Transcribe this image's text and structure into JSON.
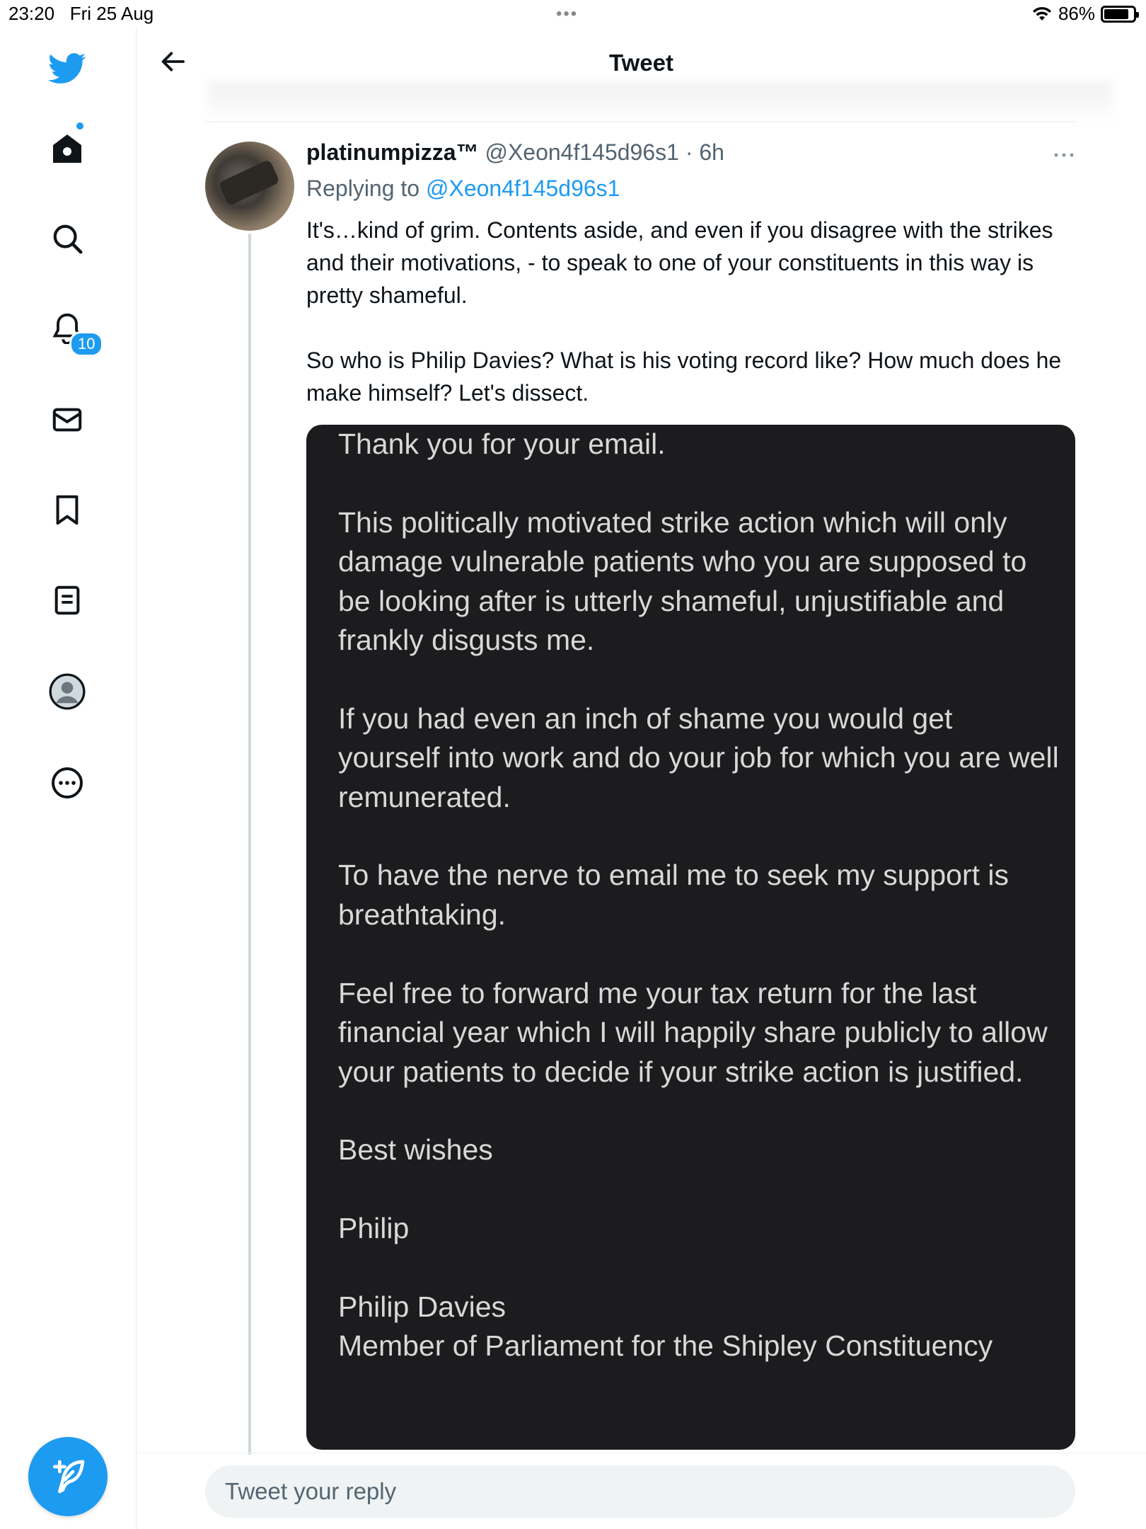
{
  "status_bar": {
    "time": "23:20",
    "date": "Fri 25 Aug",
    "dots": "•••",
    "battery": "86%",
    "battery_level": 0.86
  },
  "sidebar": {
    "items": [
      {
        "icon": "home-icon"
      },
      {
        "icon": "search-icon"
      },
      {
        "icon": "notifications-icon",
        "badge": "10"
      },
      {
        "icon": "messages-icon"
      },
      {
        "icon": "bookmarks-icon"
      },
      {
        "icon": "lists-icon"
      },
      {
        "icon": "profile-icon"
      },
      {
        "icon": "more-icon"
      }
    ],
    "compose_icon": "compose-tweet-icon"
  },
  "header": {
    "title": "Tweet",
    "back_icon": "back-arrow-icon"
  },
  "tweet": {
    "display_name": "platinumpizza™",
    "handle": "@Xeon4f145d96s1",
    "separator": "·",
    "time": "6h",
    "replying_prefix": "Replying to",
    "replying_to": "@Xeon4f145d96s1",
    "text": "It's…kind of grim. Contents aside, and even if you disagree with the strikes and their motivations, - to speak to one of your constituents in this way is pretty shameful.\n\nSo who is Philip Davies? What is his voting record like? How much does he make himself? Let's dissect.",
    "media_text": "Thank you for your email.\n\nThis politically motivated strike action which will only damage vulnerable patients who you are supposed to be looking after is utterly shameful, unjustifiable and frankly disgusts me.\n\nIf you had even an inch of shame you would get yourself into work and do your job for which you are well remunerated.\n\nTo have the nerve to email me to seek my support is breathtaking.\n\nFeel free to forward me your tax return for the last financial year which I will happily share publicly to allow your patients to decide if your strike action is justified.\n\nBest wishes\n\nPhilip\n\nPhilip Davies\nMember of Parliament for the Shipley Constituency"
  },
  "reply": {
    "placeholder": "Tweet your reply",
    "value": ""
  },
  "colors": {
    "accent": "#1d9bf0",
    "text": "#0f1419",
    "muted": "#536471",
    "media_bg": "#1c1c1e"
  }
}
